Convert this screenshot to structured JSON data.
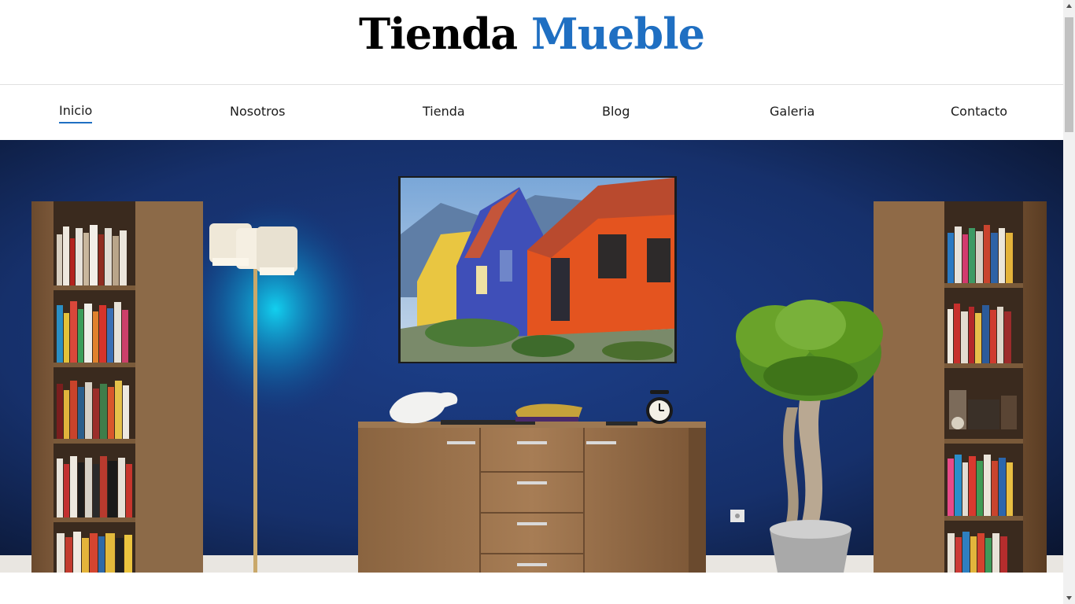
{
  "header": {
    "logo_primary": "Tienda",
    "logo_accent": "Mueble"
  },
  "nav": {
    "items": [
      {
        "label": "Inicio",
        "active": true
      },
      {
        "label": "Nosotros",
        "active": false
      },
      {
        "label": "Tienda",
        "active": false
      },
      {
        "label": "Blog",
        "active": false
      },
      {
        "label": "Galeria",
        "active": false
      },
      {
        "label": "Contacto",
        "active": false
      }
    ]
  },
  "hero": {
    "image": "living-room-photo"
  },
  "colors": {
    "accent": "#1f6fc2",
    "text": "#1a1a1a",
    "wall": "#16306b",
    "divider": "#e1e1e1"
  }
}
